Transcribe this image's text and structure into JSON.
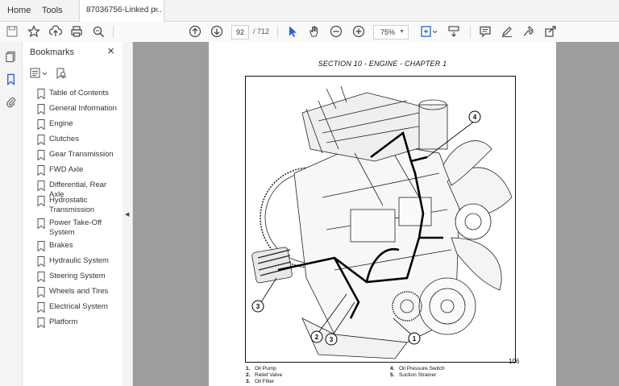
{
  "tabs": {
    "home": "Home",
    "tools": "Tools",
    "document": "87036756-Linked p...",
    "close": "×"
  },
  "toolbar": {
    "page_current": "92",
    "page_total": "/ 712",
    "zoom": "75%",
    "icons": [
      "save-icon",
      "bookmark-star-icon",
      "upload-icon",
      "print-icon",
      "search-zoom-icon",
      "prev-page-icon",
      "next-page-icon",
      "select-cursor-icon",
      "hand-tool-icon",
      "zoom-out-icon",
      "zoom-in-icon",
      "fit-page-icon",
      "scroll-mode-icon",
      "comment-icon",
      "highlight-pen-icon",
      "sign-icon",
      "share-icon"
    ]
  },
  "bookmarks": {
    "title": "Bookmarks",
    "close": "×",
    "items": [
      "Table of Contents",
      "General Information",
      "Engine",
      "Clutches",
      "Gear Transmission",
      "FWD Axle",
      "Differential, Rear Axle",
      "Hydrostatic Transmission",
      "Power Take-Off System",
      "Brakes",
      "Hydraulic System",
      "Steering System",
      "Wheels and Tires",
      "Electrical System",
      "Platform"
    ]
  },
  "page": {
    "section": "SECTION 10 - ENGINE - CHAPTER 1",
    "page_number": "106",
    "callouts": [
      "1",
      "2",
      "3",
      "3",
      "4"
    ],
    "legend_left": [
      {
        "num": "1.",
        "text": "Oil Pump"
      },
      {
        "num": "2.",
        "text": "Relief Valve"
      },
      {
        "num": "3.",
        "text": "Oil Filter"
      }
    ],
    "legend_right": [
      {
        "num": "4.",
        "text": "Oil Pressure Switch"
      },
      {
        "num": "5.",
        "text": "Suction Strainer"
      }
    ]
  }
}
